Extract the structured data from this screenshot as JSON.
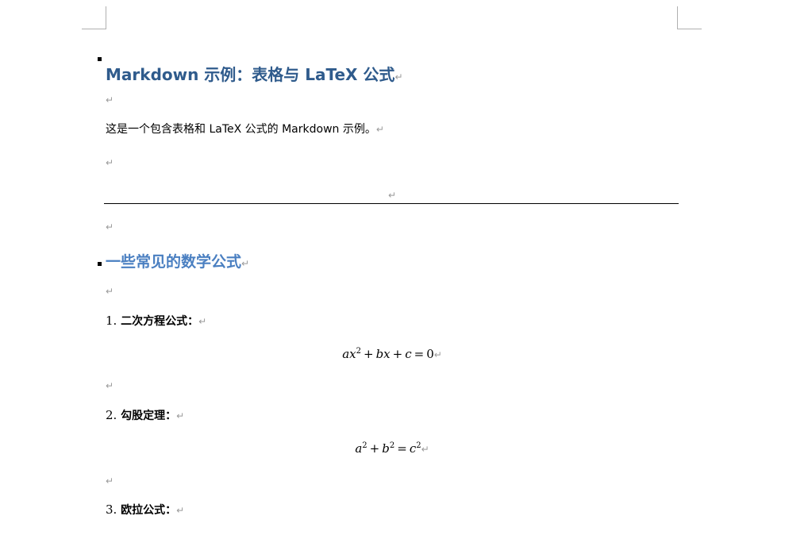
{
  "paragraph_mark": "↵",
  "heading1": "Markdown 示例：表格与 LaTeX 公式",
  "intro": "这是一个包含表格和 LaTeX 公式的 Markdown 示例。",
  "heading2": "一些常见的数学公式",
  "items": [
    {
      "number": "1.",
      "label": "二次方程公式："
    },
    {
      "number": "2.",
      "label": "勾股定理："
    },
    {
      "number": "3.",
      "label": "欧拉公式："
    }
  ],
  "equations": {
    "quadratic": {
      "a": "a",
      "x": "x",
      "exp": "2",
      "plus1": "+",
      "b": "b",
      "x2": "x",
      "plus2": "+",
      "c": "c",
      "eq": "=",
      "zero": "0"
    },
    "pythagorean": {
      "a": "a",
      "exp1": "2",
      "plus": "+",
      "b": "b",
      "exp2": "2",
      "eq": "=",
      "c": "c",
      "exp3": "2"
    }
  },
  "colors": {
    "heading1": "#2f5b8c",
    "heading2": "#4a7fc1",
    "formatting_mark": "#9a9a9a"
  }
}
